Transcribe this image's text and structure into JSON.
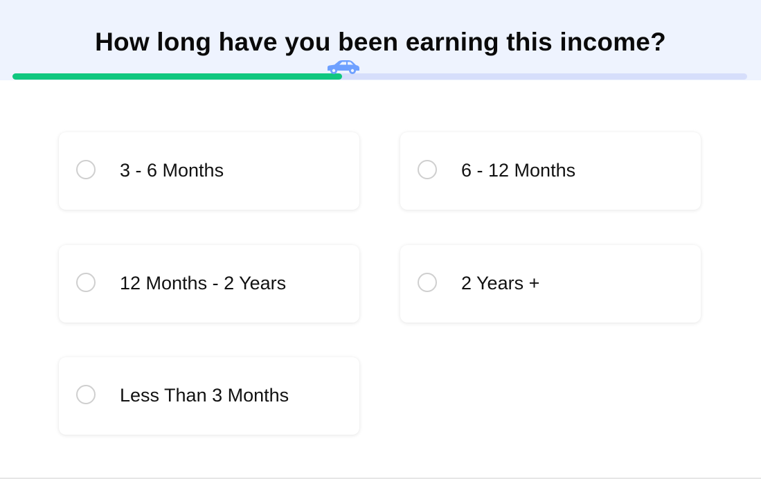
{
  "question": {
    "title": "How long have you been earning this income?"
  },
  "progress": {
    "fraction": 0.449,
    "icon": "car-icon",
    "fill_color": "#10c77f",
    "track_color": "#d6defb",
    "icon_color": "#6ea0ff"
  },
  "options": [
    {
      "label": "3 - 6 Months",
      "selected": false
    },
    {
      "label": "6 - 12 Months",
      "selected": false
    },
    {
      "label": "12 Months - 2 Years",
      "selected": false
    },
    {
      "label": "2 Years +",
      "selected": false
    },
    {
      "label": "Less Than 3 Months",
      "selected": false
    }
  ],
  "colors": {
    "header_bg": "#eef3fe",
    "text": "#0a0a0a",
    "radio_border": "#cfcfcf"
  }
}
